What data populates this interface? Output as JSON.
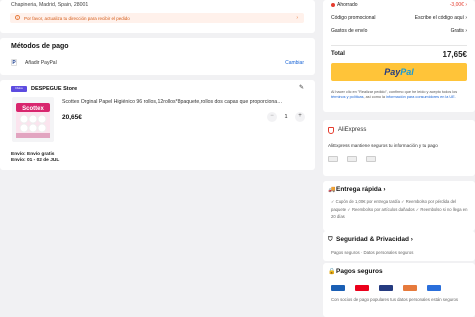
{
  "address": {
    "line": "Chapineria, Madrid, Spain, 28001",
    "warning": "Por favor, actualiza tu dirección para recibir el pedido"
  },
  "payment": {
    "title": "Métodos de pago",
    "method_badge": "P",
    "method": "Añadir PayPal",
    "change_label": "Cambiar"
  },
  "store": {
    "badge": "Choice",
    "name": "DESPEGUE Store",
    "product": {
      "title": "Scottex Orginal Papel Higiénico 96 rollos,12rollos*8paquete,rollos dos capas que proporciona…",
      "price": "20,65€",
      "quantity": "1",
      "image_brand": "Scottex"
    },
    "shipping_line1": "Envío: Envío gratis",
    "shipping_line2": "Envío: 01 - 02 de JUL"
  },
  "summary": {
    "discount_label": "Ahorrado",
    "discount_value": "-3,00€",
    "promo_label": "Código promocional",
    "promo_value": "Escribe el código aquí",
    "shipping_label": "Gastos de envío",
    "shipping_value": "Gratis",
    "total_label": "Total",
    "total_value": "17,65€",
    "paypal_part1": "Pay",
    "paypal_part2": "Pal",
    "legal_1": "Al hacer clic en \"Realizar pedido\", confirmo que he leído y acepto todos los ",
    "legal_link1": "términos y políticas",
    "legal_2": ", así como la ",
    "legal_link2": "información para consumidores en la UE."
  },
  "aliexpress": {
    "title": "AliExpress",
    "description": "AliExpress mantiene seguros tu información y tu pago"
  },
  "fast_delivery": {
    "title": "Entrega rápida",
    "text": "✓ Cupón de 1,00€ por entrega tardía  ✓ Reembolso por pérdida del paquete  ✓ Reembolso por artículos dañados  ✓ Reembolso si no llega en 20 días"
  },
  "security": {
    "title": "Seguridad & Privacidad",
    "subtitle": "Pagos seguros · Datos personales seguros"
  },
  "safe_payments": {
    "title": "Pagos seguros",
    "text": "Con socios de pago populares tus datos personales están seguros"
  },
  "colors": {
    "accent": "#e53d2f",
    "paypal_yellow": "#ffc439",
    "link": "#1763d6"
  }
}
